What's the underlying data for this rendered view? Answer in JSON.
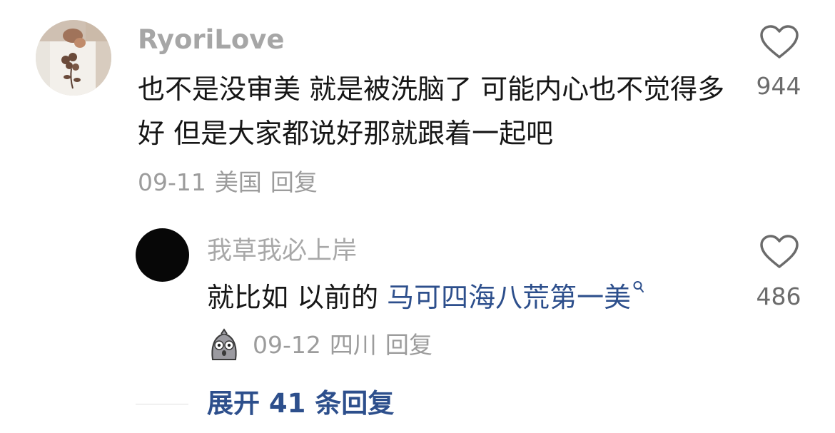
{
  "comment": {
    "username": "RyoriLove",
    "text": "也不是没审美 就是被洗脑了 可能内心也不觉得多好 但是大家都说好那就跟着一起吧",
    "date": "09-11",
    "location": "美国",
    "reply_label": "回复",
    "like_count": "944",
    "like_icon": "heart-outline-icon"
  },
  "reply": {
    "username": "我草我必上岸",
    "text_prefix": "就比如 以前的 ",
    "link_text": "马可四海八荒第一美",
    "link_icon": "search-icon",
    "badge_icon": "ghost-emoji-icon",
    "date": "09-12",
    "location": "四川",
    "reply_label": "回复",
    "like_count": "486",
    "like_icon": "heart-outline-icon"
  },
  "expand_replies": {
    "label": "展开 41 条回复"
  },
  "colors": {
    "link": "#2d4f8c",
    "secondary_text": "#9c9c9c",
    "primary_text": "#161616"
  }
}
